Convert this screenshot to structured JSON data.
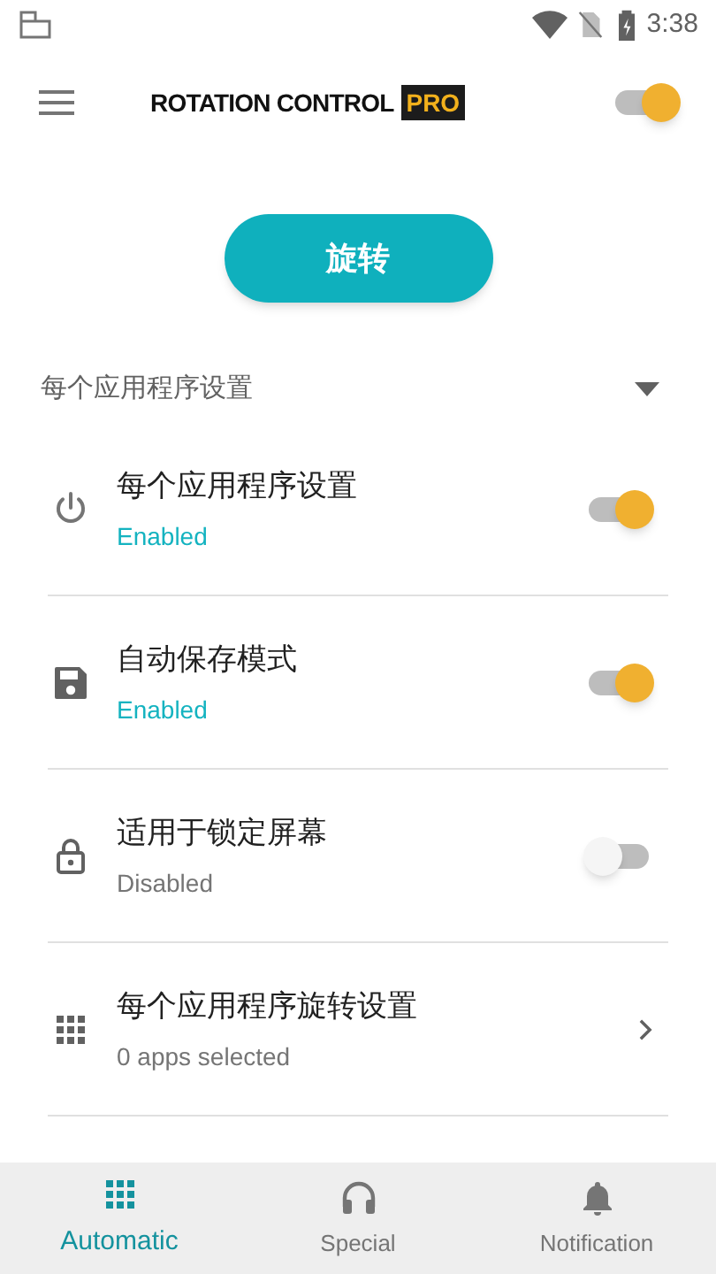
{
  "status_bar": {
    "time": "3:38"
  },
  "toolbar": {
    "logo_text": "ROTATION CONTROL",
    "logo_badge": "PRO",
    "master_on": true
  },
  "rotate_button": "旋转",
  "section": {
    "title": "每个应用程序设置",
    "expanded": true
  },
  "rows": [
    {
      "kind": "toggle",
      "title": "每个应用程序设置",
      "subtitle": "Enabled",
      "on": true
    },
    {
      "kind": "toggle",
      "title": "自动保存模式",
      "subtitle": "Enabled",
      "on": true
    },
    {
      "kind": "toggle",
      "title": "适用于锁定屏幕",
      "subtitle": "Disabled",
      "on": false
    },
    {
      "kind": "link",
      "title": "每个应用程序旋转设置",
      "subtitle": "0 apps selected"
    }
  ],
  "bottom_nav": [
    {
      "label": "Automatic",
      "selected": true
    },
    {
      "label": "Special",
      "selected": false
    },
    {
      "label": "Notification",
      "selected": false
    }
  ]
}
